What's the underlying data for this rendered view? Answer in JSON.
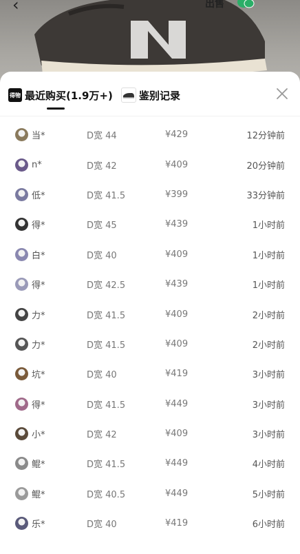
{
  "topbar": {
    "back_icon": "chevron-left-icon",
    "sell_label": "出售",
    "wechat_icon": "wechat-icon",
    "more_icon": "more-icon"
  },
  "tabs": [
    {
      "label": "最近购买(1.9万+)",
      "icon": "dewu-logo-icon",
      "icon_text": "得物",
      "active": true
    },
    {
      "label": "鉴别记录",
      "icon": "shoe-thumbnail-icon",
      "active": false
    }
  ],
  "close_icon": "close-icon",
  "records": [
    {
      "user": "当*",
      "size": "D宽 44",
      "price": "¥429",
      "time": "12分钟前",
      "avatar_color": "#8a7a5c"
    },
    {
      "user": "n*",
      "size": "D宽 42",
      "price": "¥409",
      "time": "20分钟前",
      "avatar_color": "#6a5a8a"
    },
    {
      "user": "低*",
      "size": "D宽 41.5",
      "price": "¥399",
      "time": "33分钟前",
      "avatar_color": "#7a7aa0"
    },
    {
      "user": "得*",
      "size": "D宽 45",
      "price": "¥439",
      "time": "1小时前",
      "avatar_color": "#333333"
    },
    {
      "user": "白*",
      "size": "D宽 40",
      "price": "¥409",
      "time": "1小时前",
      "avatar_color": "#8a88b0"
    },
    {
      "user": "得*",
      "size": "D宽 42.5",
      "price": "¥439",
      "time": "1小时前",
      "avatar_color": "#9a9ab8"
    },
    {
      "user": "力*",
      "size": "D宽 41.5",
      "price": "¥409",
      "time": "2小时前",
      "avatar_color": "#444444"
    },
    {
      "user": "力*",
      "size": "D宽 41.5",
      "price": "¥409",
      "time": "2小时前",
      "avatar_color": "#555555"
    },
    {
      "user": "坑*",
      "size": "D宽 40",
      "price": "¥419",
      "time": "3小时前",
      "avatar_color": "#7a5a3a"
    },
    {
      "user": "得*",
      "size": "D宽 41.5",
      "price": "¥449",
      "time": "3小时前",
      "avatar_color": "#a06a8a"
    },
    {
      "user": "小*",
      "size": "D宽 42",
      "price": "¥409",
      "time": "3小时前",
      "avatar_color": "#5a4a3a"
    },
    {
      "user": "鲲*",
      "size": "D宽 41.5",
      "price": "¥449",
      "time": "4小时前",
      "avatar_color": "#8a8a8a"
    },
    {
      "user": "鲲*",
      "size": "D宽 40.5",
      "price": "¥449",
      "time": "5小时前",
      "avatar_color": "#9a9a9a"
    },
    {
      "user": "乐*",
      "size": "D宽 40",
      "price": "¥419",
      "time": "6小时前",
      "avatar_color": "#5a5a7a"
    }
  ]
}
